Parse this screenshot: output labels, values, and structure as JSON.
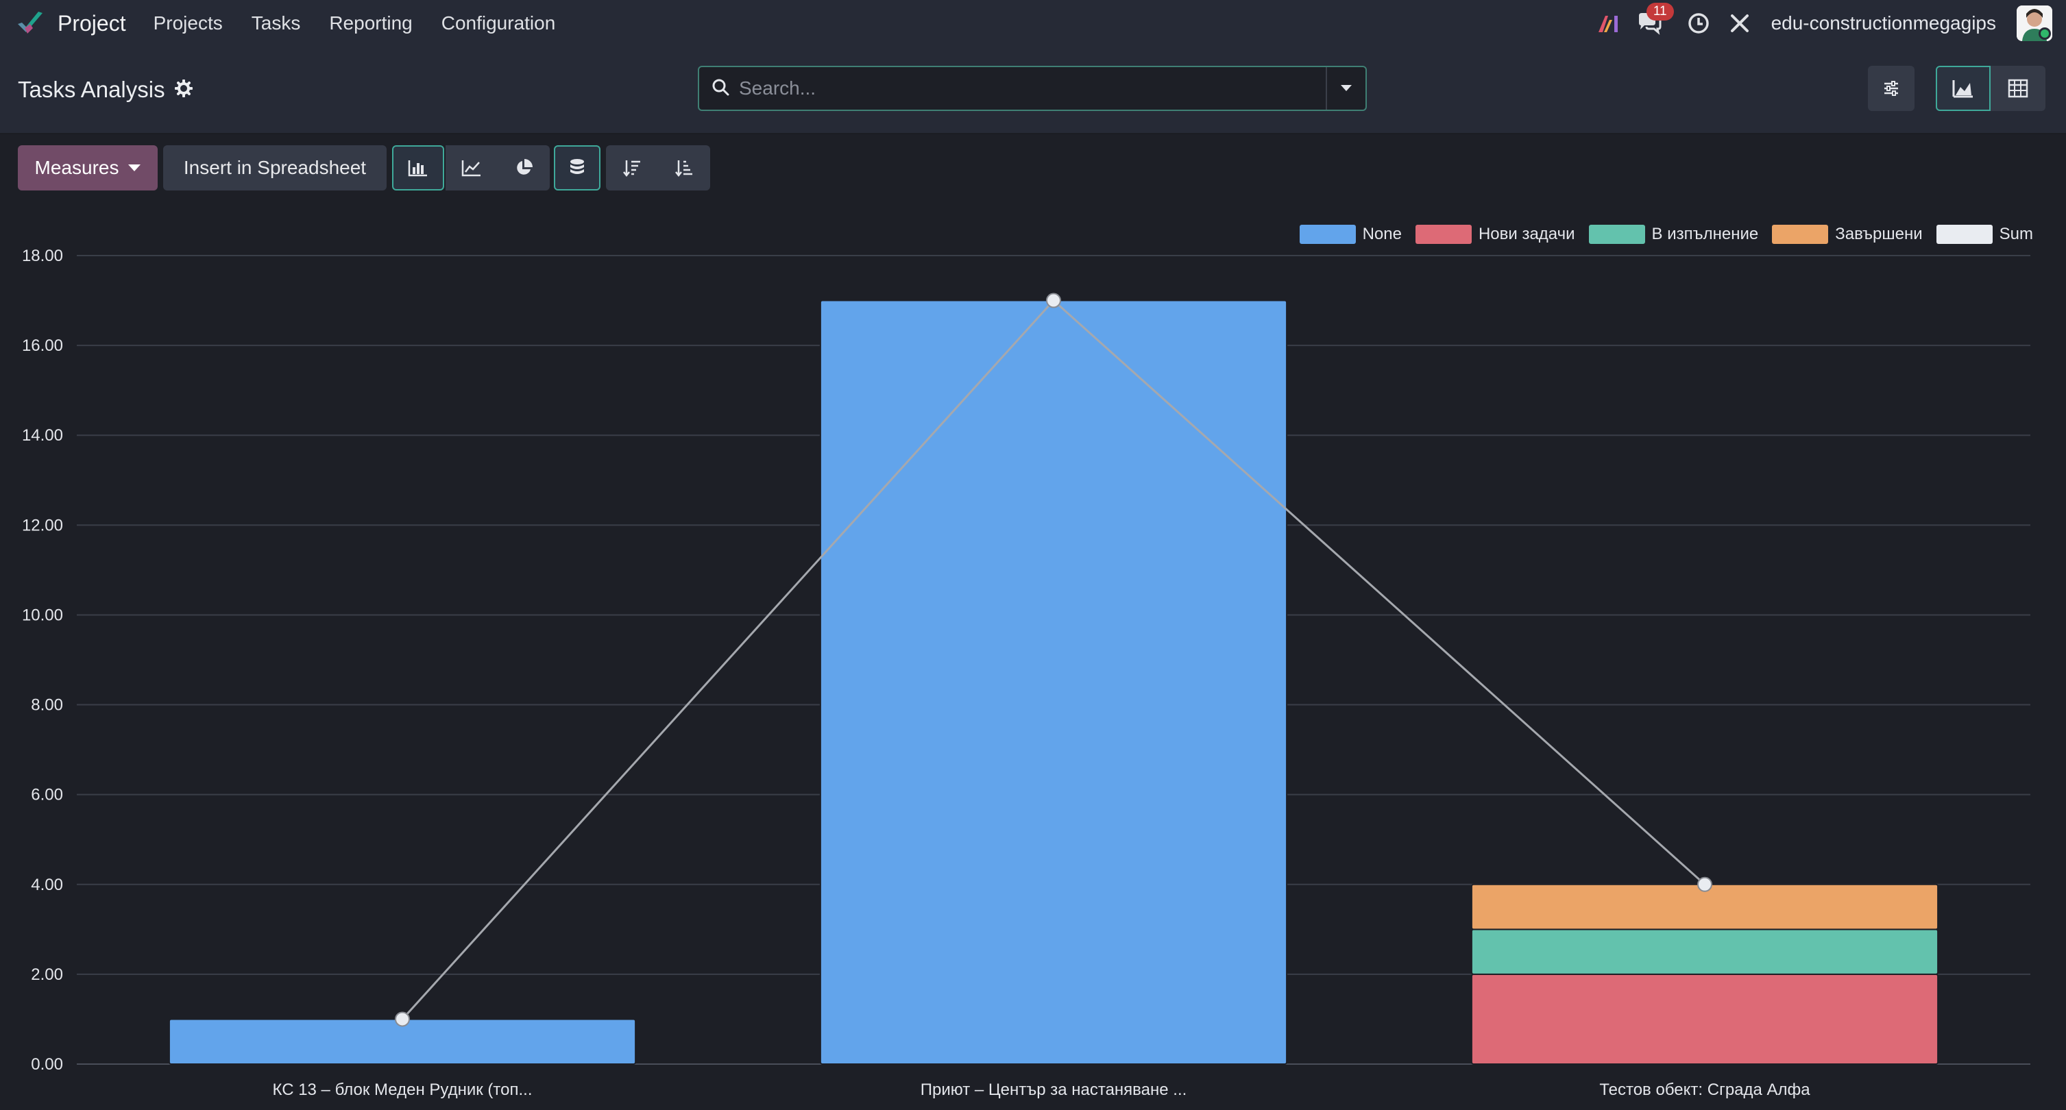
{
  "app": {
    "name": "Project"
  },
  "menu": [
    "Projects",
    "Tasks",
    "Reporting",
    "Configuration"
  ],
  "systray": {
    "messages_count": "11",
    "company": "edu-constructionmegagips"
  },
  "page": {
    "title": "Tasks Analysis"
  },
  "search": {
    "placeholder": "Search..."
  },
  "toolbar": {
    "measures_label": "Measures",
    "insert_label": "Insert in Spreadsheet"
  },
  "colors": {
    "none": "#62a4eb",
    "new": "#dd6a76",
    "progress": "#63c2ad",
    "done": "#eba467",
    "sum": "#e9ecf1",
    "accent": "#714b67"
  },
  "chart_data": {
    "type": "bar",
    "stacked": true,
    "categories": [
      "КС 13 – блок Меден Рудник (топ...",
      "Приют – Център за настаняване ...",
      "Тестов обект: Сграда Алфа"
    ],
    "series": [
      {
        "name": "None",
        "color": "#62a4eb",
        "values": [
          1,
          17,
          0
        ]
      },
      {
        "name": "Нови задачи",
        "color": "#dd6a76",
        "values": [
          0,
          0,
          2
        ]
      },
      {
        "name": "В изпълнение",
        "color": "#63c2ad",
        "values": [
          0,
          0,
          1
        ]
      },
      {
        "name": "Завършени",
        "color": "#eba467",
        "values": [
          0,
          0,
          1
        ]
      }
    ],
    "sum_line": {
      "name": "Sum",
      "color": "#e9ecf1",
      "values": [
        1,
        17,
        4
      ]
    },
    "ylim": [
      0,
      18
    ],
    "yticks": [
      "0.00",
      "2.00",
      "4.00",
      "6.00",
      "8.00",
      "10.00",
      "12.00",
      "14.00",
      "16.00",
      "18.00"
    ],
    "legend_position": "top-right",
    "grid": true
  }
}
